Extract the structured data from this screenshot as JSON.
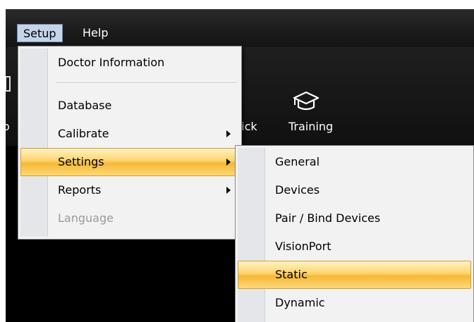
{
  "menubar": {
    "setup_label": "Setup",
    "help_label": "Help"
  },
  "toolbar": {
    "quick_label": "uick",
    "training_label": "Training",
    "left_partial_label": "o"
  },
  "setup_menu": {
    "items": [
      {
        "label": "Doctor Information",
        "submenu": false,
        "enabled": true
      },
      {
        "label": "Database",
        "submenu": false,
        "enabled": true
      },
      {
        "label": "Calibrate",
        "submenu": true,
        "enabled": true
      },
      {
        "label": "Settings",
        "submenu": true,
        "enabled": true,
        "highlighted": true
      },
      {
        "label": "Reports",
        "submenu": true,
        "enabled": true
      },
      {
        "label": "Language",
        "submenu": false,
        "enabled": false
      }
    ]
  },
  "settings_submenu": {
    "items": [
      {
        "label": "General"
      },
      {
        "label": "Devices"
      },
      {
        "label": "Pair / Bind Devices"
      },
      {
        "label": "VisionPort"
      },
      {
        "label": "Static",
        "highlighted": true
      },
      {
        "label": "Dynamic"
      }
    ]
  },
  "colors": {
    "menubar_bg": "#1c1c1c",
    "menu_bg": "#f2f2f2",
    "highlight": "#f6b837",
    "active_menu_title": "#c5d4ea"
  }
}
